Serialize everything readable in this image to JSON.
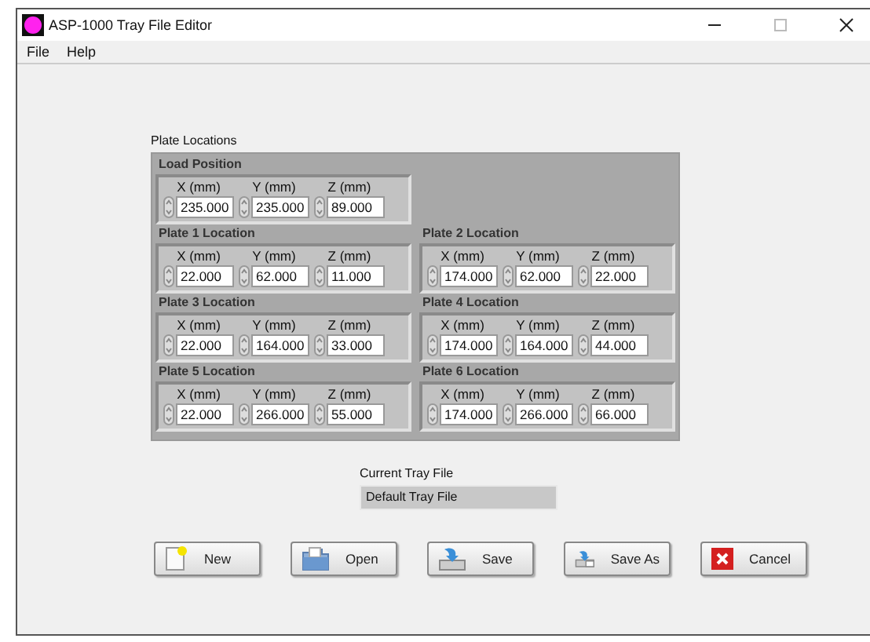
{
  "window": {
    "title": "ASP-1000 Tray File Editor"
  },
  "menu": [
    "File",
    "Help"
  ],
  "plate_locations": {
    "label": "Plate Locations",
    "rows": [
      [
        {
          "title": "Load Position",
          "fields": [
            {
              "label": "X (mm)",
              "value": "235.000"
            },
            {
              "label": "Y (mm)",
              "value": "235.000"
            },
            {
              "label": "Z (mm)",
              "value": "89.000"
            }
          ]
        }
      ],
      [
        {
          "title": "Plate 1 Location",
          "fields": [
            {
              "label": "X (mm)",
              "value": "22.000"
            },
            {
              "label": "Y (mm)",
              "value": "62.000"
            },
            {
              "label": "Z (mm)",
              "value": "11.000"
            }
          ]
        },
        {
          "title": "Plate 2 Location",
          "fields": [
            {
              "label": "X (mm)",
              "value": "174.000"
            },
            {
              "label": "Y (mm)",
              "value": "62.000"
            },
            {
              "label": "Z (mm)",
              "value": "22.000"
            }
          ]
        }
      ],
      [
        {
          "title": "Plate 3 Location",
          "fields": [
            {
              "label": "X (mm)",
              "value": "22.000"
            },
            {
              "label": "Y (mm)",
              "value": "164.000"
            },
            {
              "label": "Z (mm)",
              "value": "33.000"
            }
          ]
        },
        {
          "title": "Plate 4 Location",
          "fields": [
            {
              "label": "X (mm)",
              "value": "174.000"
            },
            {
              "label": "Y (mm)",
              "value": "164.000"
            },
            {
              "label": "Z (mm)",
              "value": "44.000"
            }
          ]
        }
      ],
      [
        {
          "title": "Plate 5 Location",
          "fields": [
            {
              "label": "X (mm)",
              "value": "22.000"
            },
            {
              "label": "Y (mm)",
              "value": "266.000"
            },
            {
              "label": "Z (mm)",
              "value": "55.000"
            }
          ]
        },
        {
          "title": "Plate 6 Location",
          "fields": [
            {
              "label": "X (mm)",
              "value": "174.000"
            },
            {
              "label": "Y (mm)",
              "value": "266.000"
            },
            {
              "label": "Z (mm)",
              "value": "66.000"
            }
          ]
        }
      ]
    ]
  },
  "current_tray_file": {
    "label": "Current Tray File",
    "value": "Default Tray File"
  },
  "buttons": [
    {
      "label": "New",
      "kind": "new"
    },
    {
      "label": "Open",
      "kind": "open"
    },
    {
      "label": "Save",
      "kind": "save"
    },
    {
      "label": "Save As",
      "kind": "saveas"
    },
    {
      "label": "Cancel",
      "kind": "cancel"
    }
  ]
}
